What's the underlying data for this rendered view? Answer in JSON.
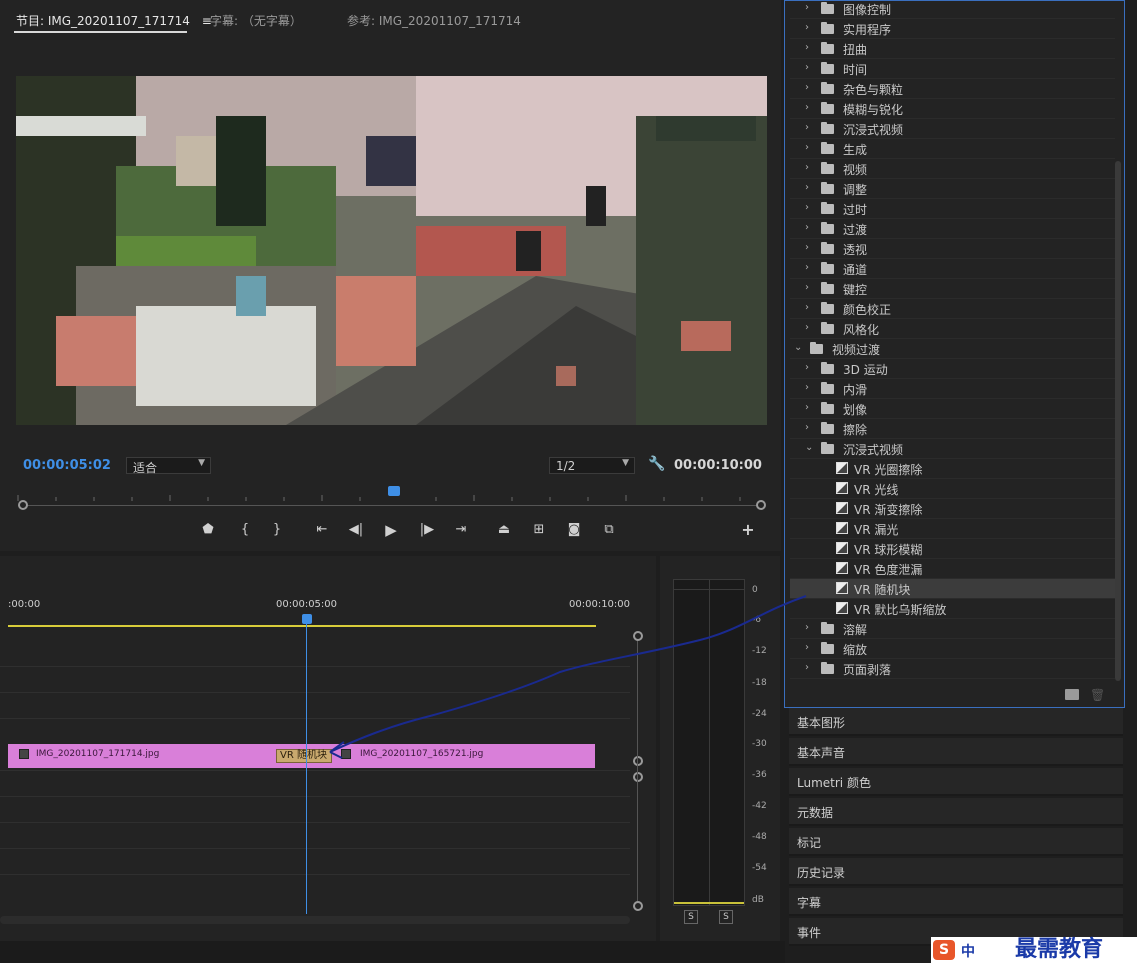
{
  "monitor": {
    "tabs": [
      {
        "label": "节目: IMG_20201107_171714",
        "menu": "≡"
      },
      {
        "label": "字幕: （无字幕）"
      },
      {
        "label": "参考: IMG_20201107_171714"
      }
    ],
    "current_timecode": "00:00:05:02",
    "fit_option": "适合",
    "resolution": "1/2",
    "duration_timecode": "00:00:10:00"
  },
  "transport": {
    "icons": [
      "marker-icon",
      "mark-in-icon",
      "mark-out-icon",
      "go-to-in-icon",
      "step-back-icon",
      "play-icon",
      "step-forward-icon",
      "go-to-out-icon",
      "lift-icon",
      "extract-icon",
      "export-frame-icon",
      "comparison-view-icon",
      "add-button-icon"
    ]
  },
  "timeline": {
    "ruler_labels": [
      ":00:00",
      "00:00:05:00",
      "00:00:10:00"
    ],
    "clip_a": "IMG_20201107_171714.jpg",
    "clip_b": "IMG_20201107_165721.jpg",
    "transition": "VR 随机块"
  },
  "meter": {
    "scale": [
      "0",
      "-6",
      "-12",
      "-18",
      "-24",
      "-30",
      "-36",
      "-42",
      "-48",
      "-54",
      "dB"
    ],
    "solo_left": "S",
    "solo_right": "S"
  },
  "effects": {
    "items": [
      {
        "label": "图像控制",
        "type": "folder",
        "expanded": false
      },
      {
        "label": "实用程序",
        "type": "folder",
        "expanded": false
      },
      {
        "label": "扭曲",
        "type": "folder",
        "expanded": false
      },
      {
        "label": "时间",
        "type": "folder",
        "expanded": false
      },
      {
        "label": "杂色与颗粒",
        "type": "folder",
        "expanded": false
      },
      {
        "label": "模糊与锐化",
        "type": "folder",
        "expanded": false
      },
      {
        "label": "沉浸式视频",
        "type": "folder",
        "expanded": false
      },
      {
        "label": "生成",
        "type": "folder",
        "expanded": false
      },
      {
        "label": "视频",
        "type": "folder",
        "expanded": false
      },
      {
        "label": "调整",
        "type": "folder",
        "expanded": false
      },
      {
        "label": "过时",
        "type": "folder",
        "expanded": false
      },
      {
        "label": "过渡",
        "type": "folder",
        "expanded": false
      },
      {
        "label": "透视",
        "type": "folder",
        "expanded": false
      },
      {
        "label": "通道",
        "type": "folder",
        "expanded": false
      },
      {
        "label": "键控",
        "type": "folder",
        "expanded": false
      },
      {
        "label": "颜色校正",
        "type": "folder",
        "expanded": false
      },
      {
        "label": "风格化",
        "type": "folder",
        "expanded": false
      },
      {
        "label": "视频过渡",
        "type": "root",
        "expanded": true
      },
      {
        "label": "3D 运动",
        "type": "folder",
        "expanded": false
      },
      {
        "label": "内滑",
        "type": "folder",
        "expanded": false
      },
      {
        "label": "划像",
        "type": "folder",
        "expanded": false
      },
      {
        "label": "擦除",
        "type": "folder",
        "expanded": false
      },
      {
        "label": "沉浸式视频",
        "type": "folder",
        "expanded": true
      },
      {
        "label": "VR 光圈擦除",
        "type": "effect"
      },
      {
        "label": "VR 光线",
        "type": "effect"
      },
      {
        "label": "VR 渐变擦除",
        "type": "effect"
      },
      {
        "label": "VR 漏光",
        "type": "effect"
      },
      {
        "label": "VR 球形模糊",
        "type": "effect"
      },
      {
        "label": "VR 色度泄漏",
        "type": "effect"
      },
      {
        "label": "VR 随机块",
        "type": "effect",
        "selected": true
      },
      {
        "label": "VR 默比乌斯缩放",
        "type": "effect"
      },
      {
        "label": "溶解",
        "type": "folder",
        "expanded": false
      },
      {
        "label": "缩放",
        "type": "folder",
        "expanded": false
      },
      {
        "label": "页面剥落",
        "type": "folder",
        "expanded": false
      }
    ]
  },
  "panels": [
    "基本图形",
    "基本声音",
    "Lumetri 颜色",
    "元数据",
    "标记",
    "历史记录",
    "字幕",
    "事件"
  ],
  "watermark": {
    "text": "最需教育",
    "ime": "中"
  },
  "colors": {
    "accent": "#3f8fe6",
    "clip": "#d97fd9",
    "playhead": "#3f8fe6",
    "arrow": "#1a2a8f"
  }
}
